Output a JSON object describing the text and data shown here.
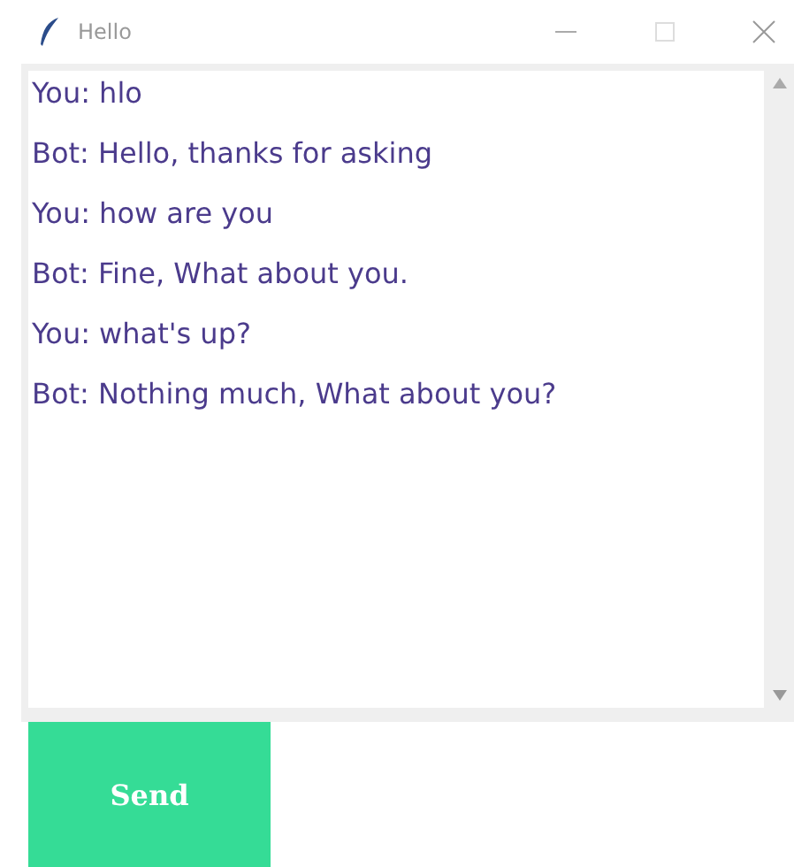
{
  "window": {
    "title": "Hello"
  },
  "messages": [
    {
      "text": "You: hlo"
    },
    {
      "text": "Bot: Hello, thanks for asking"
    },
    {
      "text": "You: how are you"
    },
    {
      "text": "Bot: Fine, What about you."
    },
    {
      "text": "You: what's up?"
    },
    {
      "text": "Bot: Nothing much, What about you?"
    }
  ],
  "send_button": {
    "label": "Send"
  }
}
